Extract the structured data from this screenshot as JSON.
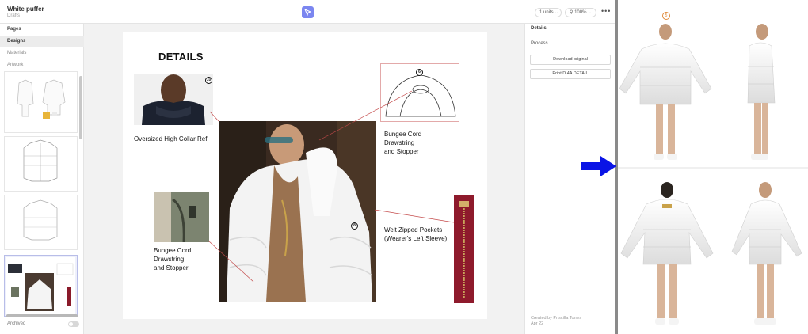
{
  "file": {
    "title": "White puffer",
    "subtitle": "Drafts"
  },
  "toolbar": {
    "units": "1 units",
    "zoom": "100%",
    "more": "•••"
  },
  "sidebar": {
    "heading": "Pages",
    "items": [
      {
        "label": "Designs",
        "active": true
      },
      {
        "label": "Materials",
        "active": false
      },
      {
        "label": "Artwork",
        "active": false
      }
    ],
    "archived_label": "Archived"
  },
  "artboard": {
    "title": "DETAILS",
    "callouts": [
      {
        "label": "Oversized High Collar Ref.",
        "pin": "10"
      },
      {
        "label_lines": [
          "Bungee Cord",
          "Drawstring",
          "and Stopper"
        ],
        "pin": "6"
      },
      {
        "label_lines": [
          "Bungee Cord",
          "Drawstring",
          "and Stopper"
        ]
      },
      {
        "label_lines": [
          "Welt Zipped Pockets",
          "(Wearer's Left Sleeve)"
        ],
        "pin": "8"
      }
    ]
  },
  "panel": {
    "sections": [
      "Details",
      "Process"
    ],
    "buttons": [
      "Download original",
      "Print D.4A DETAIL"
    ],
    "created_by": "Created by Priscilla Torres",
    "created_date": "Apr 22"
  },
  "model_pin": "5",
  "colors": {
    "accent": "#7b86f0",
    "arrow": "#0a14e6",
    "connector": "#c44a4a",
    "pin_model": "#e08a3a"
  }
}
